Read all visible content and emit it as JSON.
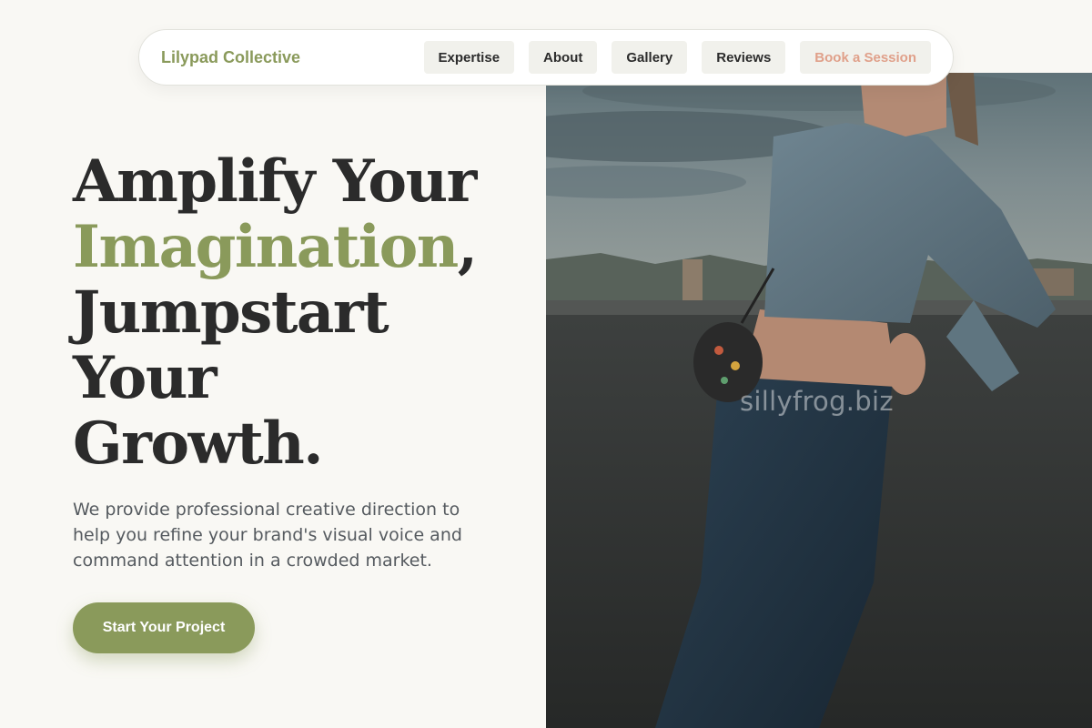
{
  "nav": {
    "brand": "Lilypad Collective",
    "links": [
      {
        "label": "Expertise"
      },
      {
        "label": "About"
      },
      {
        "label": "Gallery"
      },
      {
        "label": "Reviews"
      }
    ],
    "cta_label": "Book a Session"
  },
  "hero": {
    "headline": {
      "line1": "Amplify Your",
      "line2_accent": "Imagination",
      "line2_suffix": ",",
      "line3": "Jumpstart",
      "line4": "Your",
      "line5": "Growth."
    },
    "subtext": "We provide professional creative direction to help you refine your brand's visual voice and command attention in a crowded market.",
    "cta_label": "Start Your Project",
    "image": {
      "alt": "hero-photo-woman-denim-rooftop",
      "watermark": "sillyfrog.biz"
    }
  },
  "colors": {
    "accent": "#8a9a5b",
    "background": "#f9f8f4",
    "heading": "#2b2b2b",
    "body_text": "#555a5f",
    "nav_cta": "#e0a08a"
  }
}
